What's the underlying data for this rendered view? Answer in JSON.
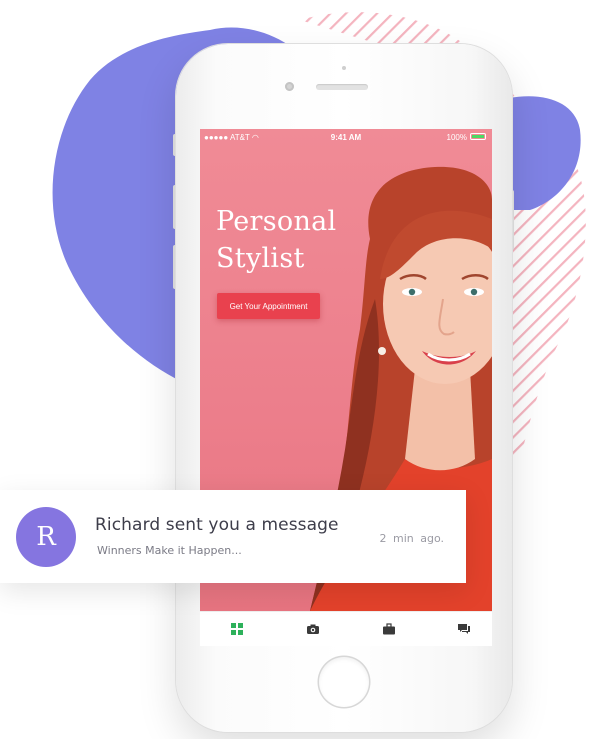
{
  "colors": {
    "blob": "#7f82e4",
    "stripes": "#f4b4bf",
    "hero_background": "#ec7e8b",
    "cta_background": "#e9414e",
    "avatar_background": "#8575e0",
    "active_tab": "#2db15b",
    "inactive_tab": "#3a3a3a"
  },
  "status_bar": {
    "carrier": "AT&T",
    "time": "9:41 AM",
    "battery": "100%"
  },
  "hero": {
    "title_line1": "Personal",
    "title_line2": "Stylist",
    "cta_label": "Get Your Appointment"
  },
  "tab_bar": {
    "tabs": [
      {
        "icon": "grid-icon",
        "active": true
      },
      {
        "icon": "camera-icon",
        "active": false
      },
      {
        "icon": "briefcase-icon",
        "active": false
      },
      {
        "icon": "chat-icon",
        "active": false
      }
    ]
  },
  "notification": {
    "avatar_letter": "R",
    "title": "Richard sent you a message",
    "body": "Winners Make it Happen...",
    "time": "2 min  ago."
  }
}
